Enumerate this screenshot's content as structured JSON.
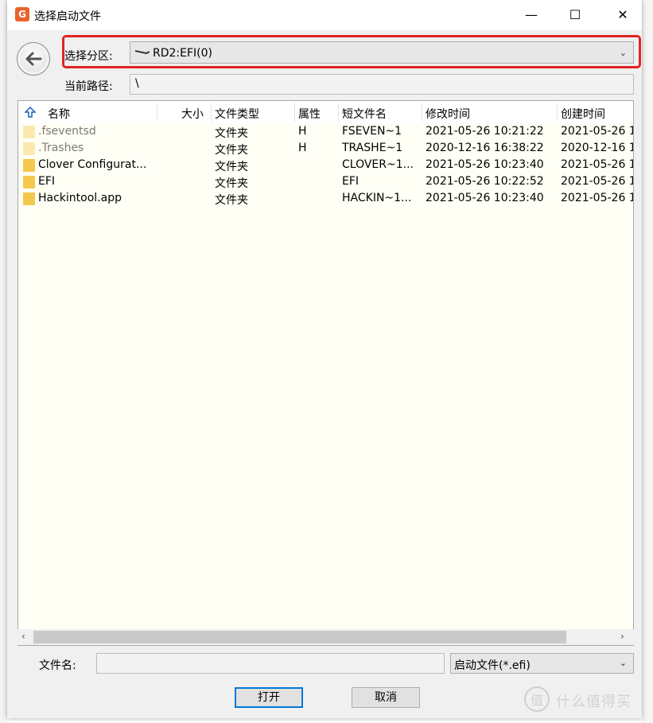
{
  "dialog": {
    "title": "选择启动文件",
    "window_buttons": {
      "minimize": "—",
      "maximize": "☐",
      "close": "✕"
    }
  },
  "partition": {
    "label": "选择分区:",
    "value": "RD2:EFI(0)"
  },
  "path": {
    "label": "当前路径:",
    "value": "\\"
  },
  "file_list": {
    "columns": [
      "名称",
      "大小",
      "文件类型",
      "属性",
      "短文件名",
      "修改时间",
      "创建时间"
    ],
    "rows": [
      {
        "name": ".fseventsd",
        "size": "",
        "type": "文件夹",
        "attr": "H",
        "short": "FSEVEN~1",
        "modified": "2021-05-26 10:21:22",
        "created": "2021-05-26 1",
        "hidden": true
      },
      {
        "name": ".Trashes",
        "size": "",
        "type": "文件夹",
        "attr": "H",
        "short": "TRASHE~1",
        "modified": "2020-12-16 16:38:22",
        "created": "2020-12-16 1",
        "hidden": true
      },
      {
        "name": "Clover Configurat...",
        "size": "",
        "type": "文件夹",
        "attr": "",
        "short": "CLOVER~1...",
        "modified": "2021-05-26 10:23:40",
        "created": "2021-05-26 1",
        "hidden": false
      },
      {
        "name": "EFI",
        "size": "",
        "type": "文件夹",
        "attr": "",
        "short": "EFI",
        "modified": "2021-05-26 10:22:52",
        "created": "2021-05-26 1",
        "hidden": false
      },
      {
        "name": "Hackintool.app",
        "size": "",
        "type": "文件夹",
        "attr": "",
        "short": "HACKIN~1...",
        "modified": "2021-05-26 10:23:40",
        "created": "2021-05-26 1",
        "hidden": false
      }
    ]
  },
  "filename": {
    "label": "文件名:",
    "value": ""
  },
  "filetype": {
    "value": "启动文件(*.efi)"
  },
  "buttons": {
    "open": "打开",
    "cancel": "取消"
  },
  "watermark": {
    "icon_text": "值",
    "text": "什么值得买"
  },
  "colors": {
    "highlight": "#e02424",
    "folder": "#f6c74e",
    "list_bg": "#fffff5",
    "default_button_border": "#0078d7"
  }
}
